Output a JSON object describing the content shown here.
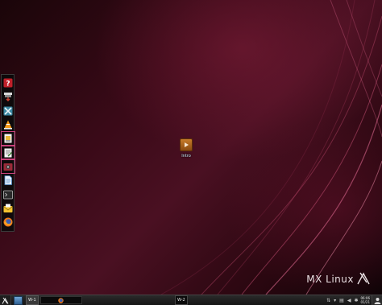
{
  "desktop": {
    "icons": [
      {
        "label": "Intro",
        "icon": "video-play-icon"
      }
    ],
    "wallpaper_logo_text": "MX Linux",
    "accent_color": "#c8417a"
  },
  "dock": {
    "items": [
      {
        "name": "help",
        "icon": "help-icon"
      },
      {
        "name": "package-installer",
        "icon": "package-installer-icon"
      },
      {
        "name": "mx-tools",
        "icon": "tools-icon"
      },
      {
        "name": "vlc",
        "icon": "vlc-icon"
      },
      {
        "name": "file-manager",
        "icon": "file-manager-icon",
        "active": true
      },
      {
        "name": "text-editor",
        "icon": "text-editor-icon",
        "active": true
      },
      {
        "name": "screenshot",
        "icon": "screenshot-icon",
        "active": true
      },
      {
        "name": "documents",
        "icon": "document-icon"
      },
      {
        "name": "terminal",
        "icon": "terminal-icon"
      },
      {
        "name": "mail",
        "icon": "mail-icon"
      },
      {
        "name": "firefox",
        "icon": "firefox-icon"
      }
    ]
  },
  "taskbar": {
    "workspace_1": "W-1",
    "workspace_2": "W-2",
    "clock_time": "06:06",
    "clock_date": "01/21"
  }
}
